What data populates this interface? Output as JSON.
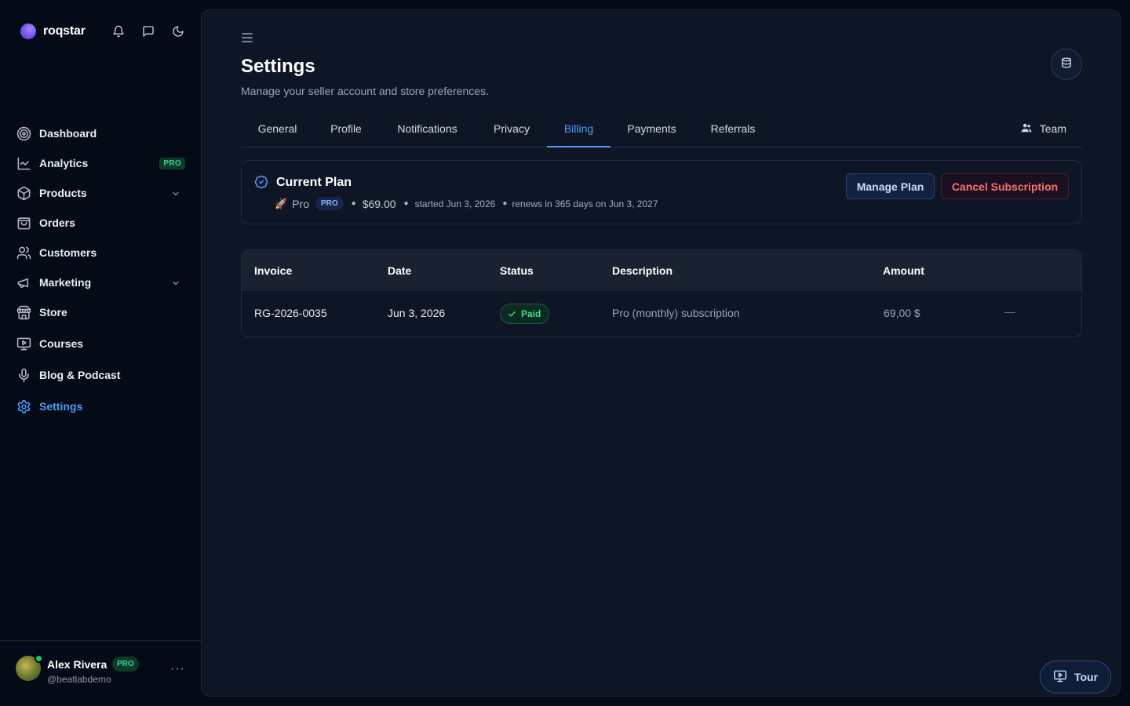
{
  "brand": {
    "name": "roqstar"
  },
  "sidebar": {
    "items": [
      {
        "label": "Dashboard",
        "icon": "target-icon"
      },
      {
        "label": "Analytics",
        "icon": "chart-line-icon",
        "badge": "PRO"
      },
      {
        "label": "Products",
        "icon": "box-icon",
        "expandable": true
      },
      {
        "label": "Orders",
        "icon": "shopping-bag-icon"
      },
      {
        "label": "Customers",
        "icon": "users-icon"
      },
      {
        "label": "Marketing",
        "icon": "megaphone-icon",
        "expandable": true
      },
      {
        "label": "Store",
        "icon": "store-icon"
      },
      {
        "label": "Courses",
        "icon": "presentation-icon"
      },
      {
        "label": "Blog & Podcast",
        "icon": "microphone-icon"
      },
      {
        "label": "Settings",
        "icon": "gear-icon",
        "active": true
      }
    ]
  },
  "user": {
    "name": "Alex Rivera",
    "badge": "PRO",
    "handle": "@beatlabdemo",
    "more": "···"
  },
  "page": {
    "title": "Settings",
    "subtitle": "Manage your seller account and store preferences."
  },
  "tabs": [
    {
      "label": "General"
    },
    {
      "label": "Profile"
    },
    {
      "label": "Notifications"
    },
    {
      "label": "Privacy"
    },
    {
      "label": "Billing",
      "active": true
    },
    {
      "label": "Payments"
    },
    {
      "label": "Referrals"
    }
  ],
  "team_tab": {
    "label": "Team"
  },
  "plan": {
    "title": "Current Plan",
    "name": "Pro",
    "badge": "PRO",
    "price": "$69.00",
    "started": "started Jun 3, 2026",
    "renews": "renews in 365 days on Jun 3, 2027",
    "manage_label": "Manage Plan",
    "cancel_label": "Cancel Subscription"
  },
  "invoices": {
    "headers": [
      "Invoice",
      "Date",
      "Status",
      "Description",
      "Amount"
    ],
    "rows": [
      {
        "invoice": "RG-2026-0035",
        "date": "Jun 3, 2026",
        "status": "Paid",
        "description": "Pro (monthly) subscription",
        "amount": "69,00 $",
        "action": "—"
      }
    ]
  },
  "tour": {
    "label": "Tour"
  },
  "colors": {
    "accent": "#4f9cf9",
    "success": "#4ade80",
    "danger": "#f87171",
    "background": "#050b16",
    "panel": "#0e1626"
  }
}
